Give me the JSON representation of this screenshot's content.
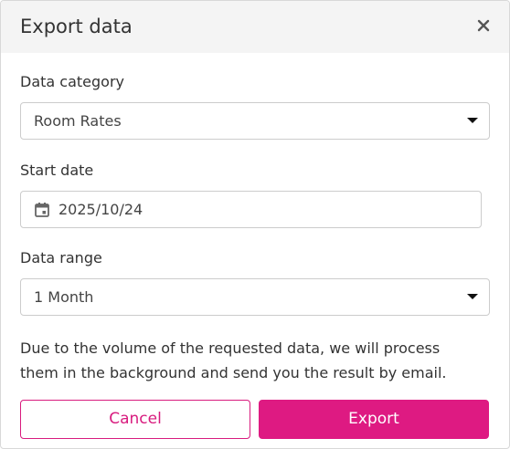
{
  "dialog": {
    "title": "Export data",
    "close_icon": "close-icon"
  },
  "form": {
    "category": {
      "label": "Data category",
      "value": "Room Rates"
    },
    "start_date": {
      "label": "Start date",
      "value": "2025/10/24",
      "icon": "calendar-icon"
    },
    "range": {
      "label": "Data range",
      "value": "1 Month"
    }
  },
  "notice": "Due to the volume of the requested data, we will process them in the background and send you the result by email.",
  "actions": {
    "cancel_label": "Cancel",
    "export_label": "Export"
  },
  "colors": {
    "accent": "#de1a82",
    "header_bg": "#f4f4f4",
    "border": "#cccccc"
  }
}
